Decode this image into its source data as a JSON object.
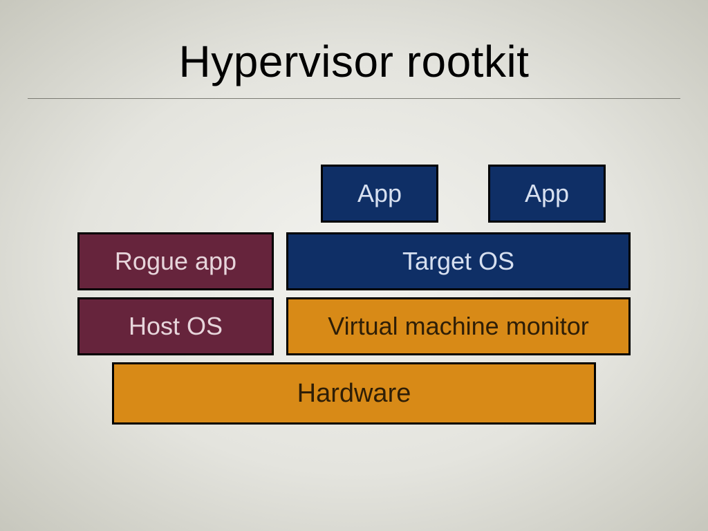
{
  "title": "Hypervisor rootkit",
  "boxes": {
    "app1": "App",
    "app2": "App",
    "rogue": "Rogue app",
    "target": "Target OS",
    "host": "Host OS",
    "vmm": "Virtual machine monitor",
    "hw": "Hardware"
  }
}
